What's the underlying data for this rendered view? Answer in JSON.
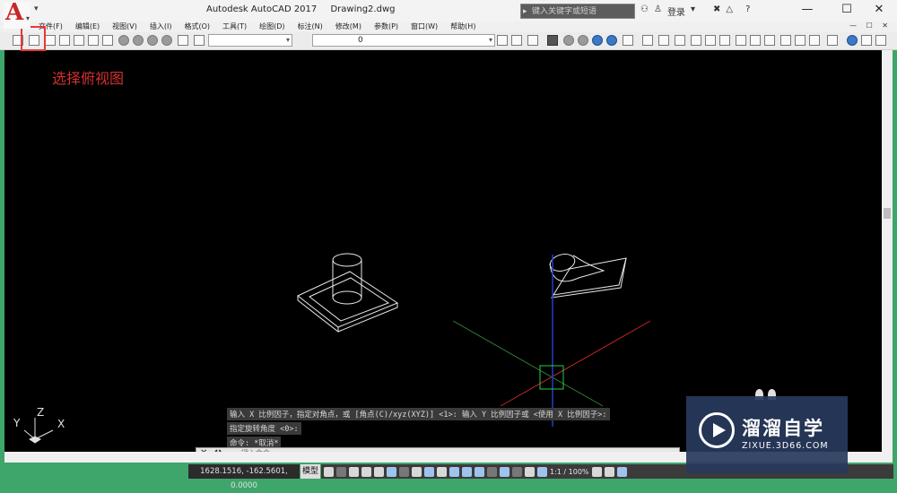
{
  "window": {
    "app_title": "Autodesk AutoCAD 2017",
    "file_name": "Drawing2.dwg",
    "search_placeholder": "键入关键字或短语",
    "sign_in": "登录",
    "minimize": "—",
    "restore": "☐",
    "close": "✕"
  },
  "logo_letter": "A",
  "menu": {
    "items": [
      "文件(F)",
      "编辑(E)",
      "视图(V)",
      "插入(I)",
      "格式(O)",
      "工具(T)",
      "绘图(D)",
      "标注(N)",
      "修改(M)",
      "参数(P)",
      "窗口(W)",
      "帮助(H)"
    ],
    "mdi_controls": "— ☐ ✕"
  },
  "toolbar": {
    "layer_value": "0"
  },
  "annotation": "选择俯视图",
  "command_history": [
    "输入 X 比例因子，指定对角点，或 [角点(C)/xyz(XYZ)] <1>:  输入 Y 比例因子或 <使用 X 比例因子>:",
    "指定旋转角度 <0>:",
    "命令: *取消*"
  ],
  "command_line": {
    "placeholder": "键入命令"
  },
  "ucs": {
    "x": "X",
    "y": "Y",
    "z": "Z"
  },
  "status": {
    "coordinates": "1628.1516, -162.5601, 0.0000",
    "model_label": "模型",
    "scale": "1:1 / 100%"
  },
  "watermark": {
    "brand": "溜溜自学",
    "url": "ZIXUE.3D66.COM"
  },
  "colors": {
    "highlight": "#e53935",
    "annotation": "#d32f2f",
    "axis_red": "#c62828",
    "axis_green": "#2e7d32",
    "axis_blue": "#1e40c8",
    "cursor_box": "#2ecc40"
  }
}
